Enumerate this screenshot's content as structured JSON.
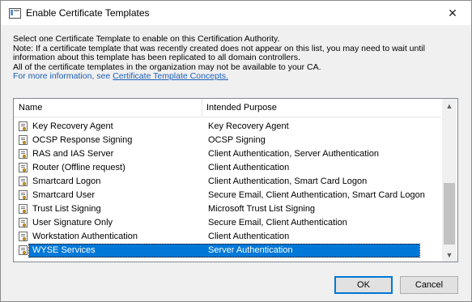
{
  "window": {
    "title": "Enable Certificate Templates",
    "close_glyph": "✕"
  },
  "info": {
    "line1": "Select one Certificate Template to enable on this Certification Authority.",
    "line2": "Note: If a certificate template that was recently created does not appear on this list, you may need to wait until",
    "line3": "information about this template has been replicated to all domain controllers.",
    "line4": "All of the certificate templates in the organization may not be available to your CA.",
    "more_prefix": "For more information, see ",
    "link_text": "Certificate Template Concepts."
  },
  "list": {
    "columns": {
      "name": "Name",
      "purpose": "Intended Purpose"
    },
    "rows": [
      {
        "name": "Key Recovery Agent",
        "purpose": "Key Recovery Agent"
      },
      {
        "name": "OCSP Response Signing",
        "purpose": "OCSP Signing"
      },
      {
        "name": "RAS and IAS Server",
        "purpose": "Client Authentication, Server Authentication"
      },
      {
        "name": "Router (Offline request)",
        "purpose": "Client Authentication"
      },
      {
        "name": "Smartcard Logon",
        "purpose": "Client Authentication, Smart Card Logon"
      },
      {
        "name": "Smartcard User",
        "purpose": "Secure Email, Client Authentication, Smart Card Logon"
      },
      {
        "name": "Trust List Signing",
        "purpose": "Microsoft Trust List Signing"
      },
      {
        "name": "User Signature Only",
        "purpose": "Secure Email, Client Authentication"
      },
      {
        "name": "Workstation Authentication",
        "purpose": "Client Authentication"
      },
      {
        "name": "WYSE Services",
        "purpose": "Server Authentication"
      }
    ],
    "selected_index": 9,
    "scrollbar": {
      "up_glyph": "▲",
      "down_glyph": "▼"
    }
  },
  "buttons": {
    "ok": "OK",
    "cancel": "Cancel"
  },
  "colors": {
    "selection": "#0078d7",
    "link": "#1c5fb8",
    "window_bg": "#f0f0f0"
  },
  "icons": {
    "row_icon": "certificate-template-icon",
    "title_icon": "certificate-window-icon"
  }
}
